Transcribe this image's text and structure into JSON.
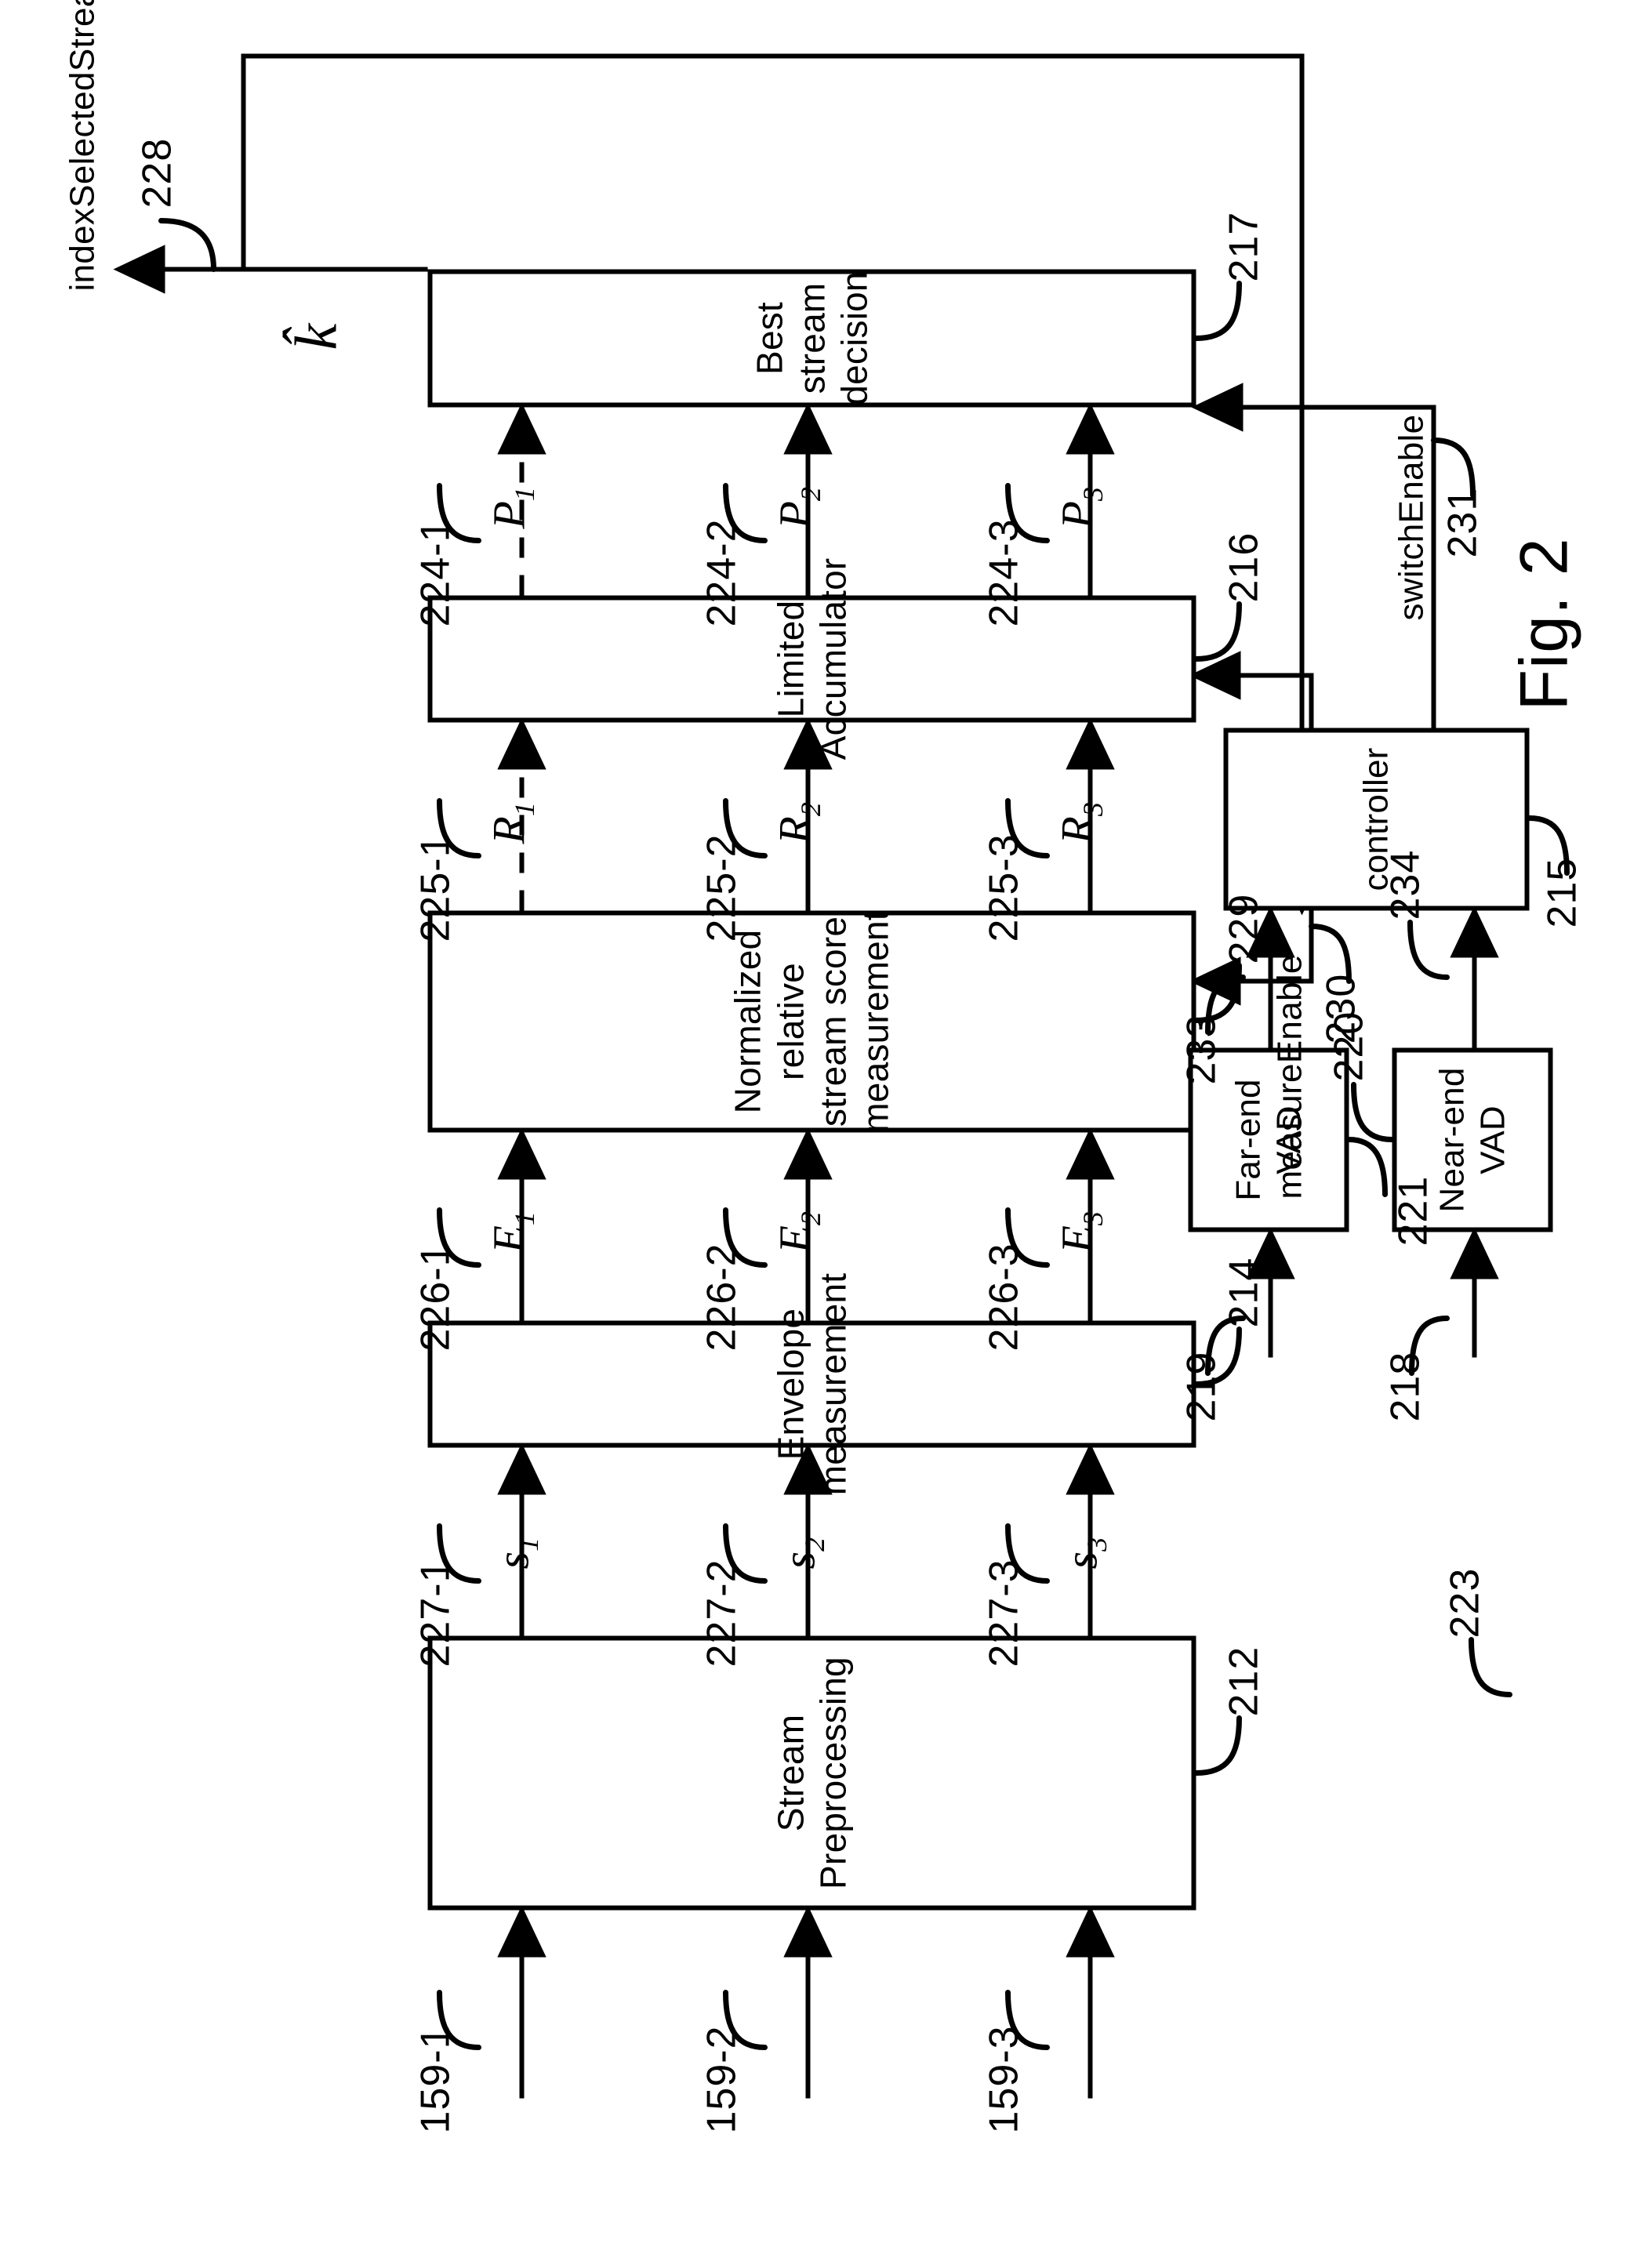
{
  "figure": {
    "caption": "Fig. 2",
    "overall_ref": "223"
  },
  "blocks": [
    {
      "id": "stream-preprocessing",
      "label": "Stream Preprocessing",
      "ref": "212"
    },
    {
      "id": "envelope-measurement",
      "label": "Envelope measurement",
      "ref": "214"
    },
    {
      "id": "normalized-score",
      "label_line1": "Normalized relative",
      "label_line2": "stream score measurement",
      "ref": "229"
    },
    {
      "id": "limited-accumulator",
      "label": "Limited Accumulator",
      "ref": "216"
    },
    {
      "id": "best-stream-decision",
      "label": "Best stream decision",
      "ref": "217"
    },
    {
      "id": "controller",
      "label": "controller",
      "ref": "215"
    },
    {
      "id": "near-end-vad",
      "label_line1": "Near-end",
      "label_line2": "VAD",
      "ref": "220"
    },
    {
      "id": "far-end-vad",
      "label_line1": "Far-end",
      "label_line2": "VAD",
      "ref": "221"
    }
  ],
  "inputs": {
    "streams": [
      {
        "ref": "159-1"
      },
      {
        "ref": "159-2"
      },
      {
        "ref": "159-3"
      }
    ],
    "near_end_ref": "218",
    "far_end_ref": "219"
  },
  "signals": {
    "preprocessed": [
      {
        "ref": "227-1",
        "symbol": "s",
        "sub": "1"
      },
      {
        "ref": "227-2",
        "symbol": "s",
        "sub": "2"
      },
      {
        "ref": "227-3",
        "symbol": "s",
        "sub": "3"
      }
    ],
    "envelopes": [
      {
        "ref": "226-1",
        "symbol": "E",
        "sub": "1"
      },
      {
        "ref": "226-2",
        "symbol": "E",
        "sub": "2"
      },
      {
        "ref": "226-3",
        "symbol": "E",
        "sub": "3"
      }
    ],
    "scores": [
      {
        "ref": "225-1",
        "symbol": "R",
        "sub": "1"
      },
      {
        "ref": "225-2",
        "symbol": "R",
        "sub": "2"
      },
      {
        "ref": "225-3",
        "symbol": "R",
        "sub": "3"
      }
    ],
    "accumulated": [
      {
        "ref": "224-1",
        "symbol": "P",
        "sub": "1"
      },
      {
        "ref": "224-2",
        "symbol": "P",
        "sub": "2"
      },
      {
        "ref": "224-3",
        "symbol": "P",
        "sub": "3"
      }
    ],
    "control": [
      {
        "name": "switchEnable",
        "ref": "231"
      },
      {
        "name": "measureEnable",
        "ref": "230"
      }
    ],
    "vad_out": [
      {
        "ref": "234"
      },
      {
        "ref": "233"
      }
    ],
    "output": {
      "symbol": "k̂",
      "name": "indexSelectedStream",
      "ref": "228"
    }
  },
  "colors": {
    "line": "#000000",
    "background": "#ffffff"
  }
}
